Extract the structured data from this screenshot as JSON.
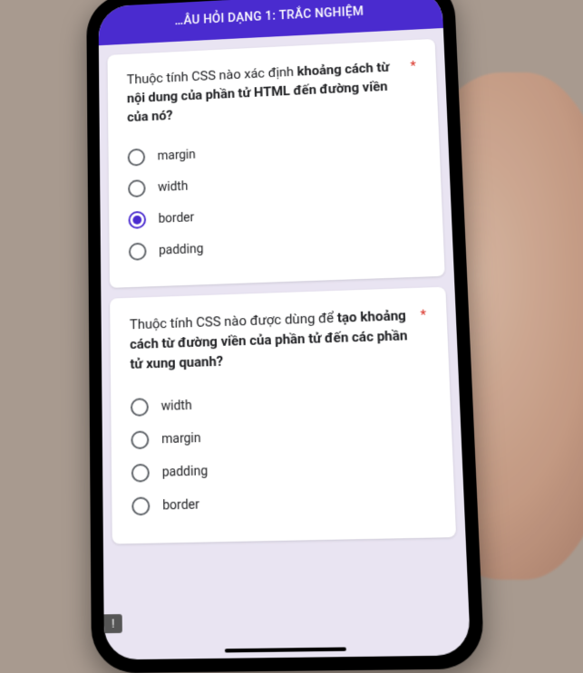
{
  "header": {
    "title_partial": "…ÂU HỎI DẠNG 1: TRẮC NGHIỆM"
  },
  "questions": [
    {
      "prompt_pre": "Thuộc tính CSS nào xác định ",
      "prompt_bold": "khoảng cách từ nội dung của phần tử HTML đến đường viền của nó?",
      "required": true,
      "options": [
        {
          "label": "margin",
          "selected": false
        },
        {
          "label": "width",
          "selected": false
        },
        {
          "label": "border",
          "selected": true
        },
        {
          "label": "padding",
          "selected": false
        }
      ]
    },
    {
      "prompt_pre": "Thuộc tính CSS nào được dùng để ",
      "prompt_bold": "tạo khoảng cách từ đường viền của phần tử đến các phần tử xung quanh?",
      "required": true,
      "options": [
        {
          "label": "width",
          "selected": false
        },
        {
          "label": "margin",
          "selected": false
        },
        {
          "label": "padding",
          "selected": false
        },
        {
          "label": "border",
          "selected": false
        }
      ]
    }
  ],
  "feedback_icon_glyph": "!"
}
